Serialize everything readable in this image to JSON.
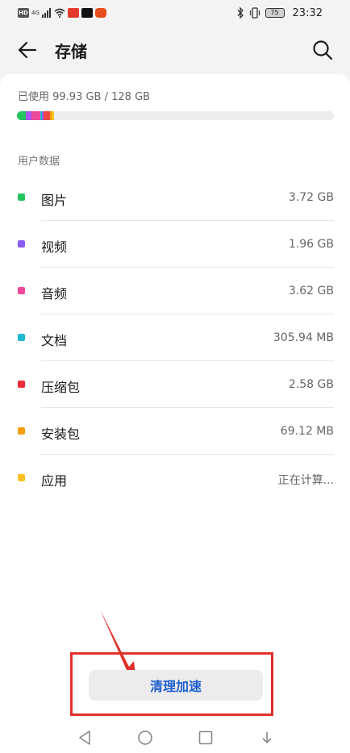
{
  "status_bar": {
    "left_labels": [
      "HD",
      "4G"
    ],
    "battery": "75",
    "time": "23:32"
  },
  "header": {
    "title": "存储",
    "back_icon": "arrow-left-icon",
    "search_icon": "search-icon"
  },
  "storage": {
    "usage_text": "已使用 99.93 GB / 128 GB",
    "bar_segments": [
      {
        "color": "#22c55e",
        "fraction": 0.029
      },
      {
        "color": "#a855f7",
        "fraction": 0.016
      },
      {
        "color": "#ec4899",
        "fraction": 0.028
      },
      {
        "color": "#22b8cf",
        "fraction": 0.006
      },
      {
        "color": "#8b5cf6",
        "fraction": 0.005
      },
      {
        "color": "#ef4444",
        "fraction": 0.02
      },
      {
        "color": "#f59e0b",
        "fraction": 0.006
      },
      {
        "color": "#fbbf24",
        "fraction": 0.006
      }
    ]
  },
  "section_label": "用户数据",
  "items": [
    {
      "name": "图片",
      "size": "3.72 GB",
      "color": "#22c55e"
    },
    {
      "name": "视频",
      "size": "1.96 GB",
      "color": "#8b5cf6"
    },
    {
      "name": "音频",
      "size": "3.62 GB",
      "color": "#ec4899"
    },
    {
      "name": "文档",
      "size": "305.94 MB",
      "color": "#22b8cf"
    },
    {
      "name": "压缩包",
      "size": "2.58 GB",
      "color": "#ef2b3a"
    },
    {
      "name": "安装包",
      "size": "69.12 MB",
      "color": "#f59e0b"
    },
    {
      "name": "应用",
      "size": "正在计算...",
      "color": "#fbbf24"
    }
  ],
  "clean_button": {
    "label": "清理加速"
  },
  "accent": {
    "highlight": "#e0312a",
    "button_text": "#1f5fd0"
  }
}
